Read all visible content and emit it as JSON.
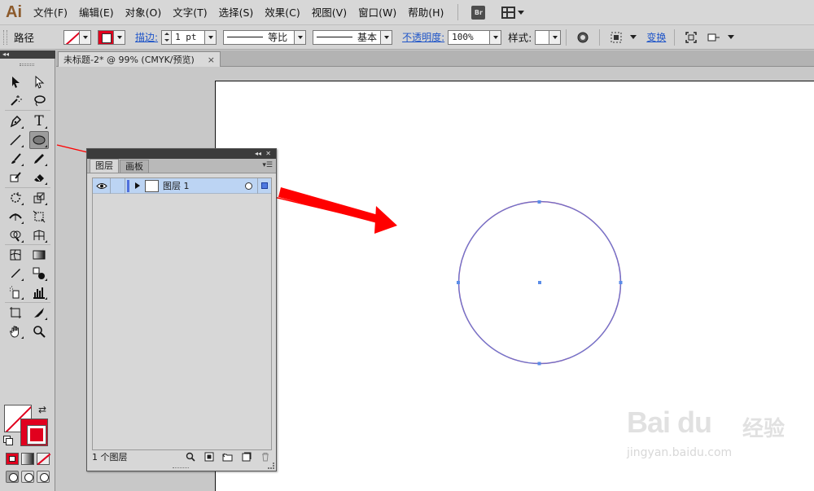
{
  "app": {
    "logo": "Ai"
  },
  "menu": {
    "items": [
      "文件(F)",
      "编辑(E)",
      "对象(O)",
      "文字(T)",
      "选择(S)",
      "效果(C)",
      "视图(V)",
      "窗口(W)",
      "帮助(H)"
    ],
    "bridge_label": "Br"
  },
  "control_bar": {
    "selection_label": "路径",
    "stroke_link": "描边:",
    "stroke_weight": "1 pt",
    "stroke_profile": "等比",
    "brush_definition": "基本",
    "opacity_link": "不透明度:",
    "opacity_value": "100%",
    "style_label": "样式:",
    "transform_link": "变换"
  },
  "document": {
    "tab_label": "未标题-2* @ 99% (CMYK/预览)",
    "close_glyph": "×"
  },
  "layers_panel": {
    "tabs": [
      "图层",
      "画板"
    ],
    "layers": [
      {
        "name": "图层 1"
      }
    ],
    "footer_count": "1 个图层"
  },
  "toolbar": {
    "text_tool_glyph": "T",
    "swap_glyph": "⇄"
  },
  "colors": {
    "accent_red": "#e1001e",
    "selection_blue": "#4f79e0",
    "layer_row_bg": "#bcd4f3",
    "circle_stroke": "#8a4fa3",
    "arrow_red": "#ff0000"
  },
  "watermark": {
    "brand": "Bai du",
    "brand_cn": "经验",
    "url": "jingyan.baidu.com"
  }
}
